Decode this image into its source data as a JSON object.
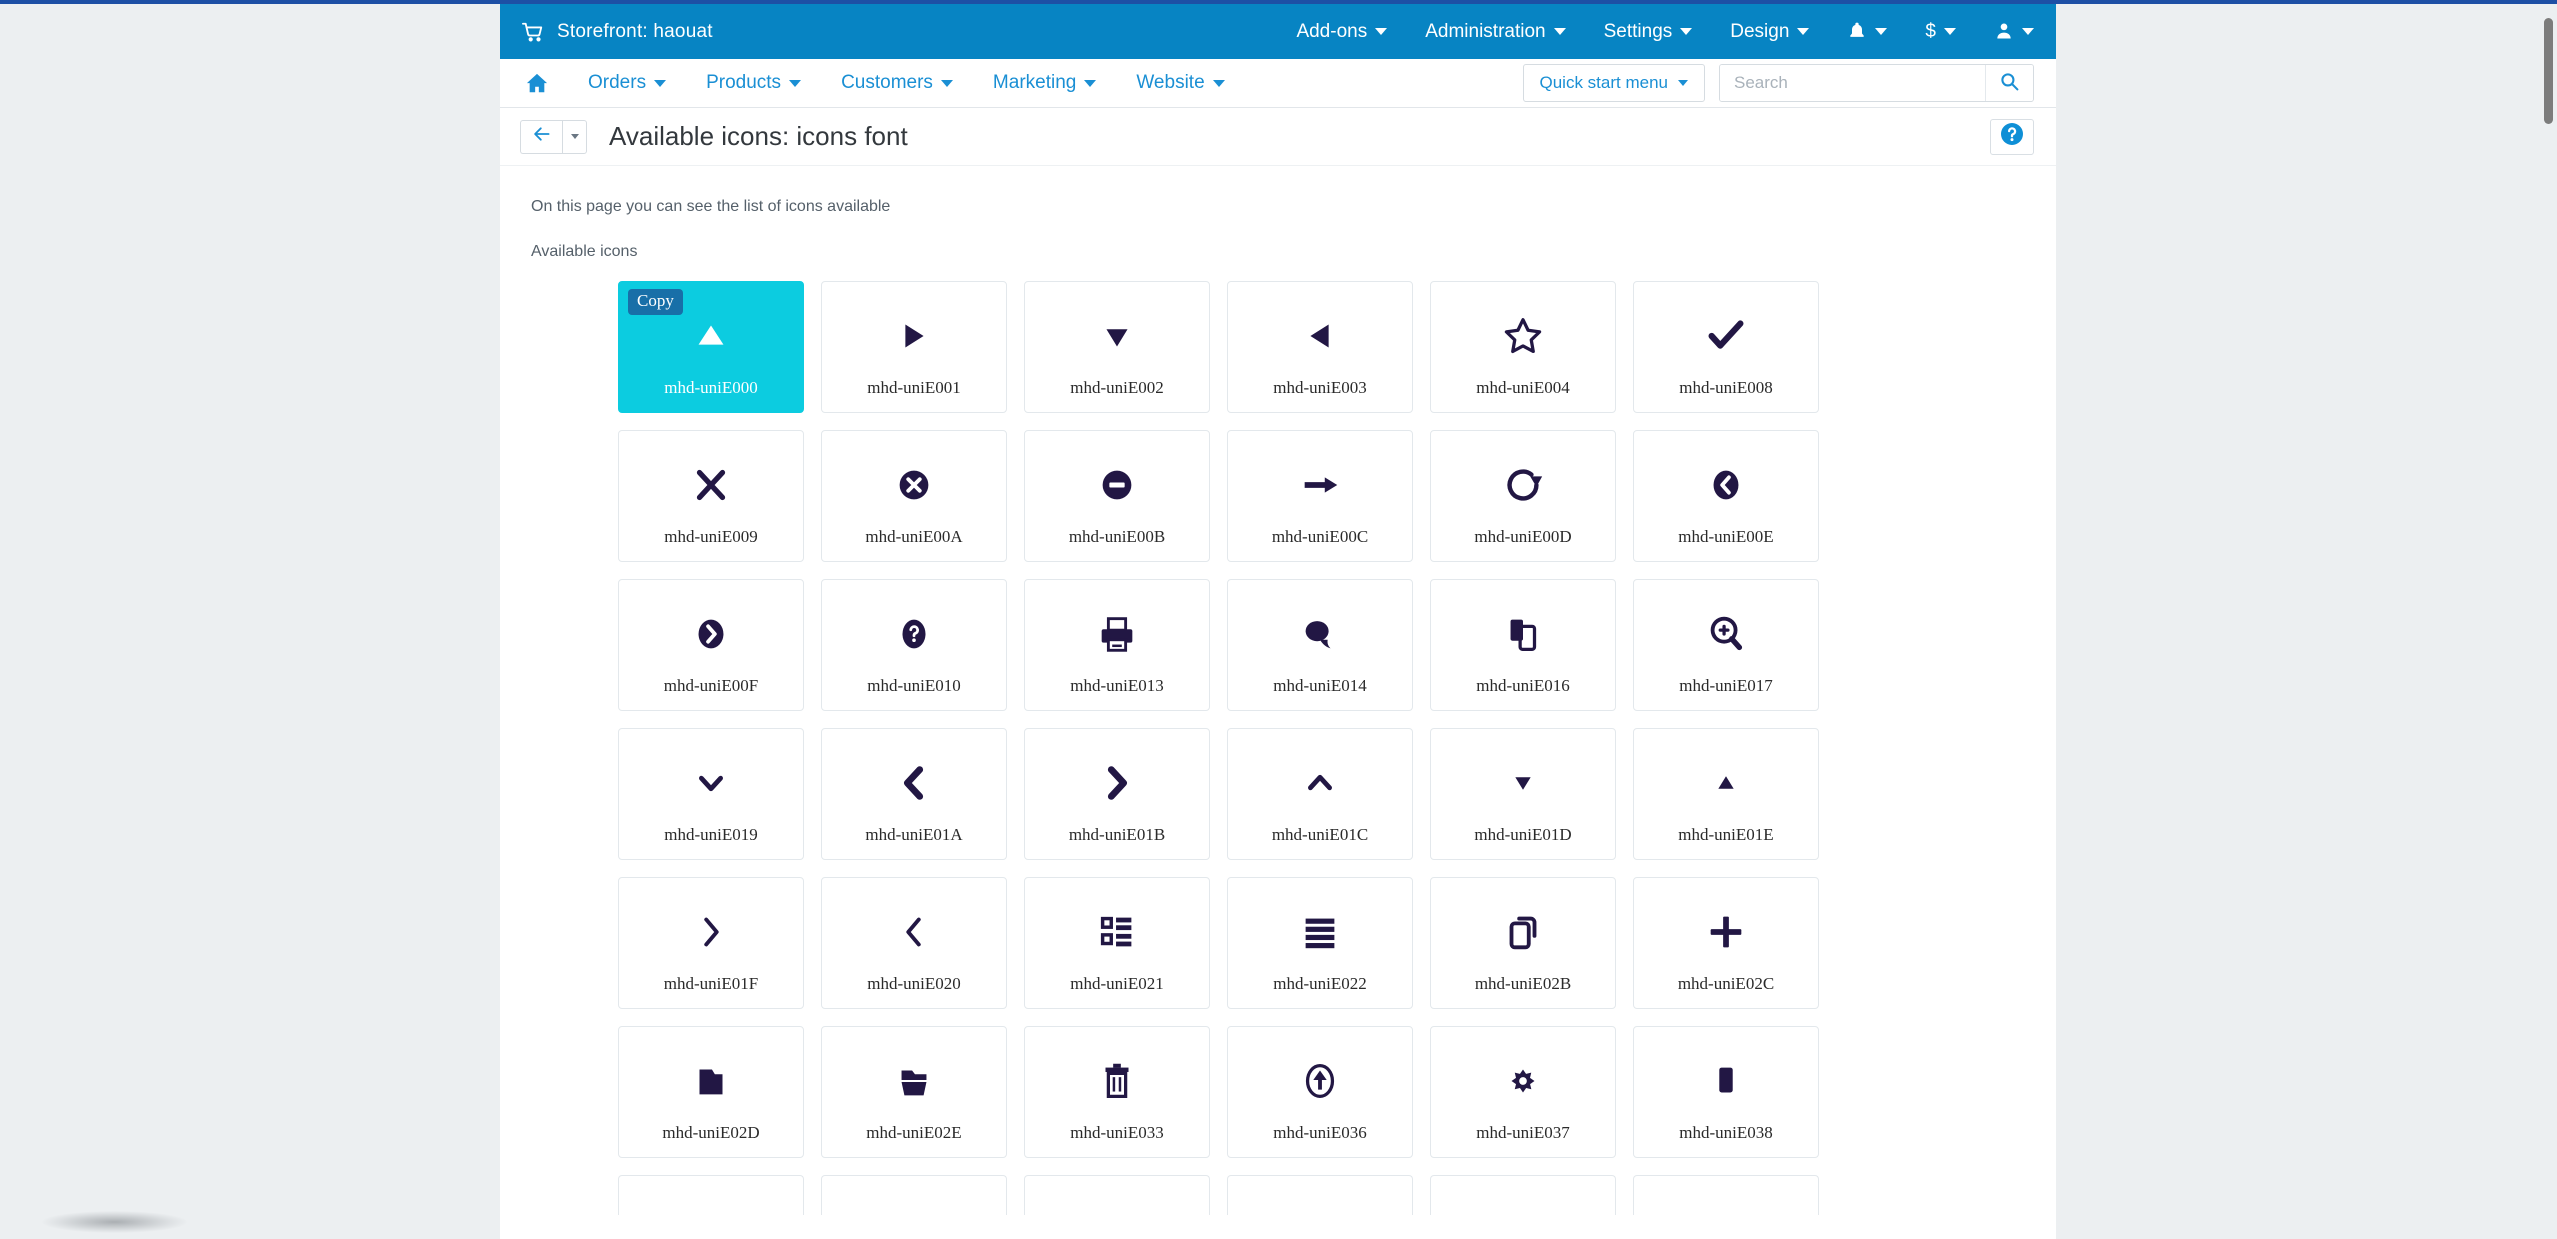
{
  "topbar": {
    "cart_icon": "shopping-cart-icon",
    "store_title": "Storefront: haouat",
    "menus": [
      {
        "label": "Add-ons"
      },
      {
        "label": "Administration"
      },
      {
        "label": "Settings"
      },
      {
        "label": "Design"
      }
    ],
    "notifications_icon": "bell-icon",
    "currency_label": "$",
    "user_icon": "user-icon"
  },
  "subnav": {
    "home_icon": "home-icon",
    "items": [
      {
        "label": "Orders"
      },
      {
        "label": "Products"
      },
      {
        "label": "Customers"
      },
      {
        "label": "Marketing"
      },
      {
        "label": "Website"
      }
    ],
    "quick_start_label": "Quick start menu",
    "search": {
      "value": "",
      "placeholder": "Search"
    },
    "search_icon": "search-icon"
  },
  "titlebar": {
    "back_icon": "arrow-left-icon",
    "dropdown_icon": "chevron-down-icon",
    "title": "Available icons: icons font",
    "help_icon": "question-circle-icon"
  },
  "content": {
    "description": "On this page you can see the list of icons available",
    "section_label": "Available icons",
    "copy_badge": "Copy",
    "icons": [
      {
        "name": "mhd-uniE000",
        "icon": "triangle-up-filled-icon",
        "active": true
      },
      {
        "name": "mhd-uniE001",
        "icon": "triangle-right-filled-icon",
        "active": false
      },
      {
        "name": "mhd-uniE002",
        "icon": "triangle-down-filled-icon",
        "active": false
      },
      {
        "name": "mhd-uniE003",
        "icon": "triangle-left-filled-icon",
        "active": false
      },
      {
        "name": "mhd-uniE004",
        "icon": "star-outline-icon",
        "active": false
      },
      {
        "name": "mhd-uniE008",
        "icon": "check-icon",
        "active": false
      },
      {
        "name": "mhd-uniE009",
        "icon": "close-x-icon",
        "active": false
      },
      {
        "name": "mhd-uniE00A",
        "icon": "close-circle-icon",
        "active": false
      },
      {
        "name": "mhd-uniE00B",
        "icon": "minus-circle-icon",
        "active": false
      },
      {
        "name": "mhd-uniE00C",
        "icon": "arrow-right-icon",
        "active": false
      },
      {
        "name": "mhd-uniE00D",
        "icon": "refresh-icon",
        "active": false
      },
      {
        "name": "mhd-uniE00E",
        "icon": "chevron-left-circle-icon",
        "active": false
      },
      {
        "name": "mhd-uniE00F",
        "icon": "chevron-right-circle-icon",
        "active": false
      },
      {
        "name": "mhd-uniE010",
        "icon": "question-circle-icon",
        "active": false
      },
      {
        "name": "mhd-uniE013",
        "icon": "printer-icon",
        "active": false
      },
      {
        "name": "mhd-uniE014",
        "icon": "chat-bubbles-icon",
        "active": false
      },
      {
        "name": "mhd-uniE016",
        "icon": "copy-pages-icon",
        "active": false
      },
      {
        "name": "mhd-uniE017",
        "icon": "zoom-in-icon",
        "active": false
      },
      {
        "name": "mhd-uniE019",
        "icon": "chevron-down-icon",
        "active": false
      },
      {
        "name": "mhd-uniE01A",
        "icon": "chevron-left-bold-icon",
        "active": false
      },
      {
        "name": "mhd-uniE01B",
        "icon": "chevron-right-bold-icon",
        "active": false
      },
      {
        "name": "mhd-uniE01C",
        "icon": "chevron-up-icon",
        "active": false
      },
      {
        "name": "mhd-uniE01D",
        "icon": "triangle-down-small-icon",
        "active": false
      },
      {
        "name": "mhd-uniE01E",
        "icon": "triangle-up-small-icon",
        "active": false
      },
      {
        "name": "mhd-uniE01F",
        "icon": "chevron-right-thin-icon",
        "active": false
      },
      {
        "name": "mhd-uniE020",
        "icon": "chevron-left-thin-icon",
        "active": false
      },
      {
        "name": "mhd-uniE021",
        "icon": "list-view-icon",
        "active": false
      },
      {
        "name": "mhd-uniE022",
        "icon": "menu-lines-icon",
        "active": false
      },
      {
        "name": "mhd-uniE02B",
        "icon": "copy-documents-icon",
        "active": false
      },
      {
        "name": "mhd-uniE02C",
        "icon": "plus-icon",
        "active": false
      },
      {
        "name": "mhd-uniE02D",
        "icon": "folder-icon",
        "active": false
      },
      {
        "name": "mhd-uniE02E",
        "icon": "folder-open-icon",
        "active": false
      },
      {
        "name": "mhd-uniE033",
        "icon": "trash-icon",
        "active": false
      },
      {
        "name": "mhd-uniE036",
        "icon": "arrow-up-circle-icon",
        "active": false
      },
      {
        "name": "mhd-uniE037",
        "icon": "gear-icon",
        "active": false
      },
      {
        "name": "mhd-uniE038",
        "icon": "square-filled-icon",
        "active": false
      }
    ]
  },
  "colors": {
    "topbar_blue": "#0784c3",
    "link_blue": "#1a8fd4",
    "active_cell": "#0ccce0",
    "copy_badge": "#186fa8",
    "glyph": "#221744",
    "page_bg": "#eceff1"
  }
}
